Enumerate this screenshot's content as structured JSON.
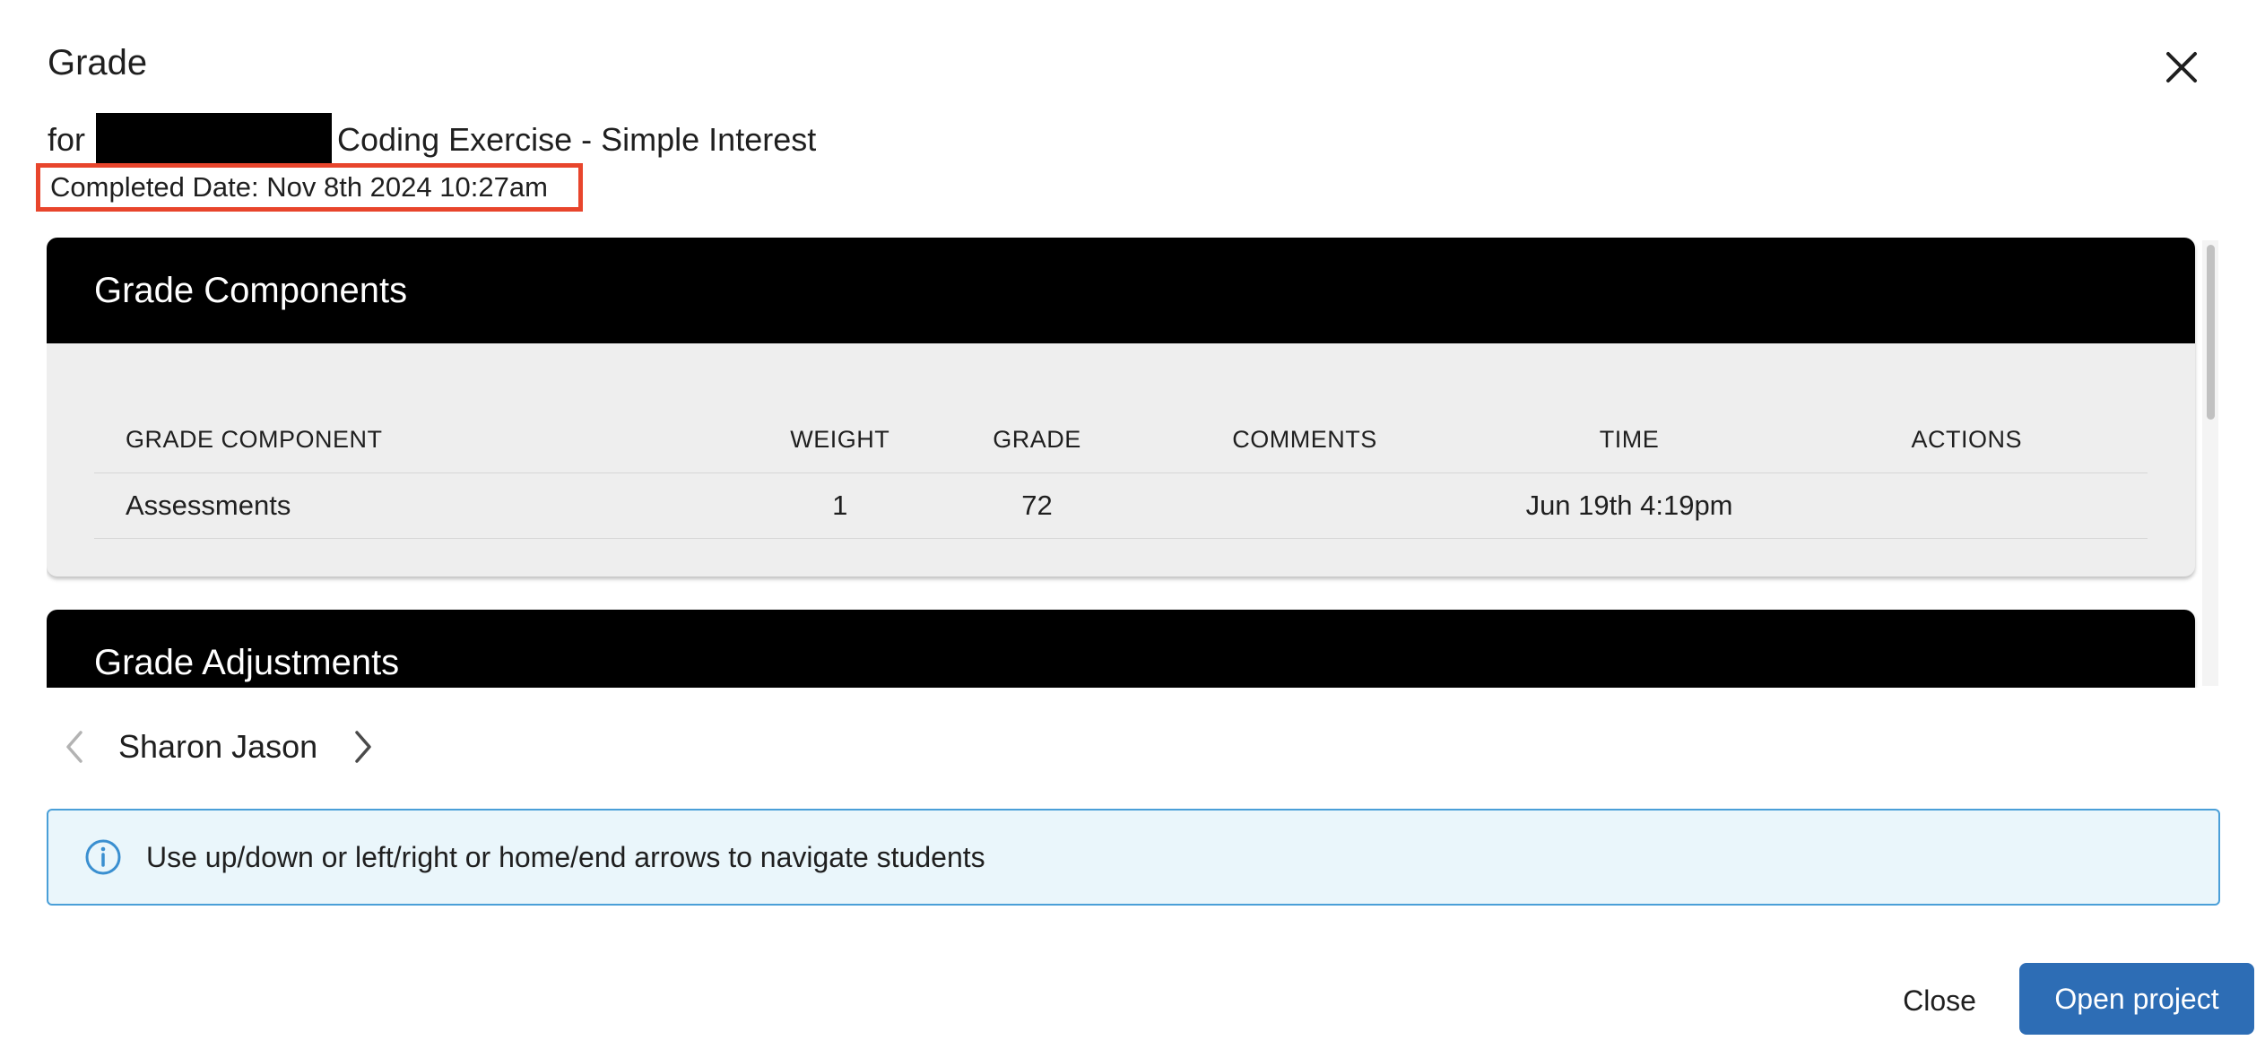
{
  "dialog": {
    "title": "Grade",
    "subtitle_prefix": "for",
    "subtitle_assignment": "Coding Exercise - Simple Interest",
    "completed_date": "Completed Date: Nov 8th 2024 10:27am"
  },
  "grade_components": {
    "header": "Grade Components",
    "columns": [
      "GRADE COMPONENT",
      "WEIGHT",
      "GRADE",
      "COMMENTS",
      "TIME",
      "ACTIONS"
    ],
    "rows": [
      {
        "component": "Assessments",
        "weight": "1",
        "grade": "72",
        "comments": "",
        "time": "Jun 19th 4:19pm",
        "actions": ""
      }
    ]
  },
  "grade_adjustments": {
    "header": "Grade Adjustments"
  },
  "student_nav": {
    "student_name": "Sharon Jason"
  },
  "info": {
    "text": "Use up/down or left/right or home/end arrows to navigate students"
  },
  "footer": {
    "close_label": "Close",
    "open_label": "Open project"
  },
  "colors": {
    "card_header": "#000000",
    "card_body": "#eeeeee",
    "highlight_box": "#e8452c",
    "info_border": "#4a9fd8",
    "info_bg": "#eaf6fb",
    "primary_button": "#2d6db5"
  }
}
